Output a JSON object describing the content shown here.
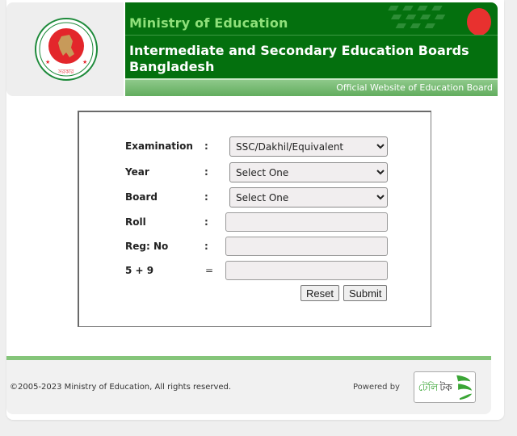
{
  "header": {
    "ministry": "Ministry of Education",
    "board_title": "Intermediate and Secondary Education Boards Bangladesh",
    "tagline": "Official Website of Education Board",
    "logo_name": "government-seal-logo"
  },
  "form": {
    "fields": [
      {
        "label": "Examination",
        "separator": ":",
        "type": "select",
        "value": "SSC/Dakhil/Equivalent"
      },
      {
        "label": "Year",
        "separator": ":",
        "type": "select",
        "value": "Select One"
      },
      {
        "label": "Board",
        "separator": ":",
        "type": "select",
        "value": "Select One"
      },
      {
        "label": "Roll",
        "separator": ":",
        "type": "text",
        "value": ""
      },
      {
        "label": "Reg: No",
        "separator": ":",
        "type": "text",
        "value": ""
      },
      {
        "label": "5 + 9",
        "separator": "=",
        "type": "text",
        "value": ""
      }
    ],
    "reset_label": "Reset",
    "submit_label": "Submit"
  },
  "footer": {
    "copyright": "©2005-2023 Ministry of Education, All rights reserved.",
    "powered_by": "Powered by",
    "partner_logo": "teletalk-logo"
  },
  "colors": {
    "banner_green": "#04700e",
    "ministry_text": "#8fe07a",
    "accent_line": "#85c57a"
  }
}
